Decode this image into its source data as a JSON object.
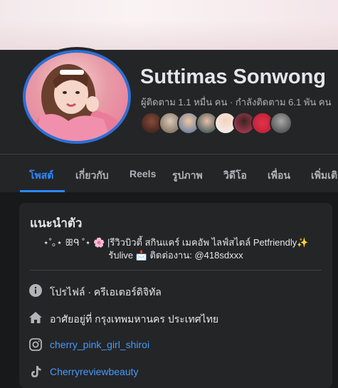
{
  "profile": {
    "name": "Suttimas Sonwong",
    "stats": "ผู้ติดตาม 1.1 หมื่น คน · กำลังติดตาม 6.1 พัน คน"
  },
  "tabs": [
    {
      "label": "โพสต์"
    },
    {
      "label": "เกี่ยวกับ"
    },
    {
      "label": "Reels"
    },
    {
      "label": "รูปภาพ"
    },
    {
      "label": "วิดีโอ"
    },
    {
      "label": "เพื่อน"
    },
    {
      "label": "เพิ่มเติม"
    }
  ],
  "intro": {
    "title": "แนะนำตัว",
    "bio_line1": "⋆˚｡⋆ ꕥᑫ ˚⋆ 🌸 |รีวิวบิวตี้ สกินแคร์ เมคอัพ ไลฟ์สไตล์ Petfriendly✨",
    "bio_line2": "รับlive 📩 ติดต่องาน: @418sdxxx"
  },
  "details": [
    {
      "icon": "info-icon",
      "text": "โปรไฟล์ · ครีเอเตอร์ดิจิทัล"
    },
    {
      "icon": "home-icon",
      "text": "อาศัยอยู่ที่ กรุงเทพมหานคร ประเทศไทย"
    },
    {
      "icon": "instagram-icon",
      "text": "cherry_pink_girl_shiroi"
    },
    {
      "icon": "tiktok-icon",
      "text": "Cherryreviewbeauty"
    }
  ],
  "colors": {
    "accent": "#2d88ff",
    "avatar_ring": "#2d6fd6",
    "background": "#18191a",
    "panel": "#242526"
  }
}
